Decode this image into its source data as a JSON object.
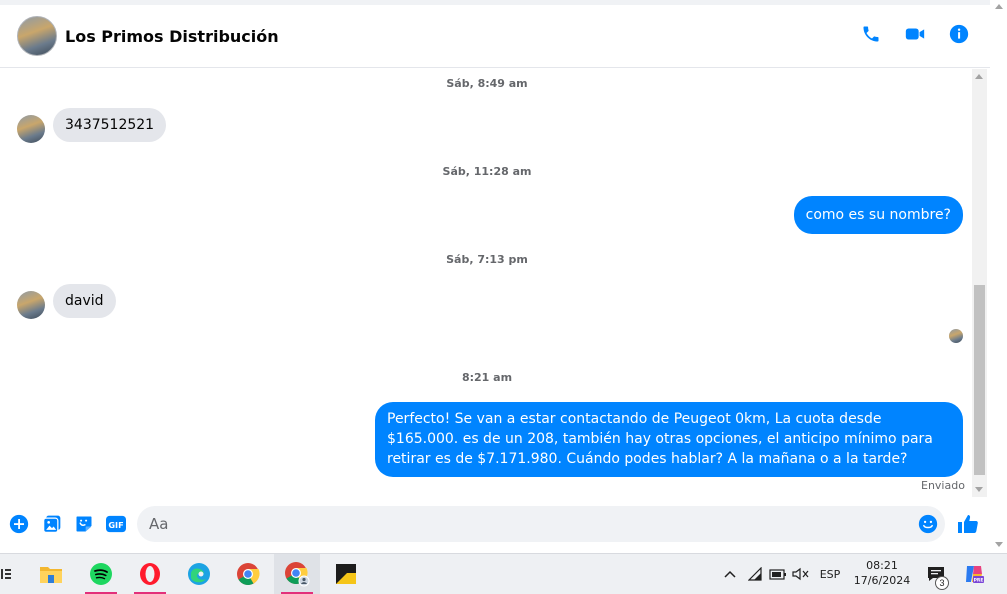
{
  "header": {
    "title": "Los Primos Distribución"
  },
  "messages": [
    {
      "type": "timestamp",
      "text": "Sáb, 8:49 am"
    },
    {
      "type": "incoming",
      "text": "3437512521"
    },
    {
      "type": "timestamp",
      "text": "Sáb, 11:28 am"
    },
    {
      "type": "outgoing",
      "text": "como es su nombre?"
    },
    {
      "type": "timestamp",
      "text": "Sáb, 7:13 pm"
    },
    {
      "type": "incoming",
      "text": "david"
    },
    {
      "type": "timestamp",
      "text": "8:21 am"
    },
    {
      "type": "outgoing",
      "text": "Perfecto!  Se van a estar contactando de Peugeot 0km, La cuota desde $165.000. es de un 208, también hay otras opciones, el anticipo mínimo para retirar es de $7.171.980. Cuándo podes hablar? A la mañana o a la tarde?"
    }
  ],
  "status": "Enviado",
  "composer": {
    "placeholder": "Aa"
  },
  "taskbar": {
    "language": "ESP",
    "time": "08:21",
    "date": "17/6/2024",
    "notification_count": "3"
  },
  "colors": {
    "accent": "#0084ff",
    "incoming_bubble": "#e4e6eb"
  }
}
